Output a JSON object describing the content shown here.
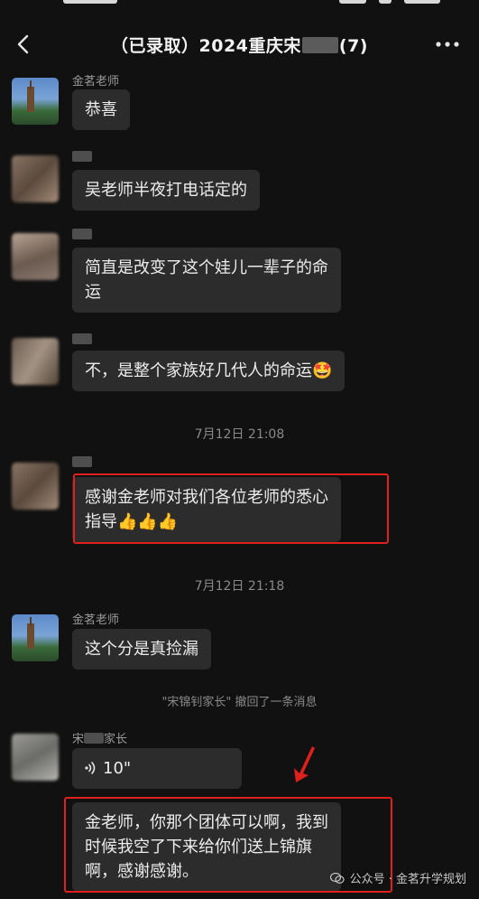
{
  "header": {
    "title_prefix": "（已录取）2024重庆宋",
    "title_suffix": "(7)"
  },
  "messages": [
    {
      "sender": "金茗老师",
      "text": "恭喜"
    },
    {
      "sender_initial": "",
      "text": "吴老师半夜打电话定的"
    },
    {
      "sender_initial": "",
      "text_line1": "简直是改变了这个娃儿一辈子的命",
      "text_line2": "运"
    },
    {
      "sender_initial": "",
      "text": "不，是整个家族好几代人的命运",
      "emoji": "🤩"
    },
    {
      "timestamp": "7月12日 21:08"
    },
    {
      "sender_initial": "",
      "text_line1": "感谢金老师对我们各位老师的悉心",
      "text_line2": "指导",
      "emoji": "👍👍👍"
    },
    {
      "timestamp": "7月12日 21:18"
    },
    {
      "sender": "金茗老师",
      "text": "这个分是真捡漏"
    },
    {
      "recall": "\"宋锦钊家长\" 撤回了一条消息"
    },
    {
      "sender_prefix": "宋",
      "sender_suffix": "家长",
      "voice_duration": "10\""
    },
    {
      "text_line1": "金老师，你那个团体可以啊，我到",
      "text_line2": "时候我空了下来给你们送上锦旗",
      "text_line3": "啊，感谢感谢。"
    }
  ],
  "watermark": {
    "text": "公众号 · 金茗升学规划"
  },
  "colors": {
    "background": "#111111",
    "bubble": "#2c2c2c",
    "highlight": "#e0201c"
  },
  "icons": [
    "back-arrow-icon",
    "more-dots-icon",
    "voice-icon",
    "red-arrow-icon",
    "wechat-icon"
  ]
}
